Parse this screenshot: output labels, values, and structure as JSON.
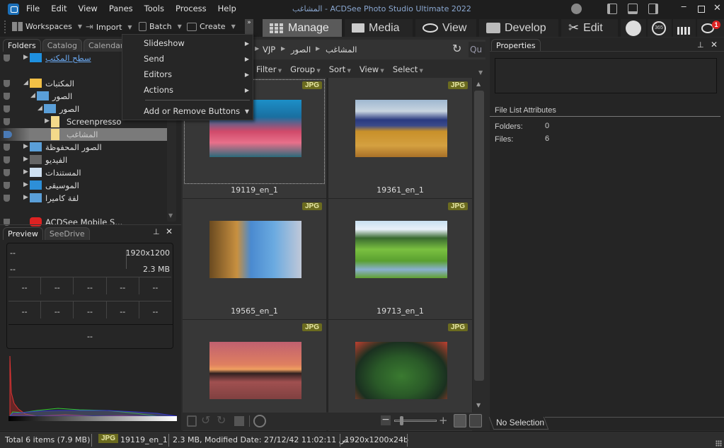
{
  "window": {
    "title": "المشاغب - ACDSee Photo Studio Ultimate 2022",
    "controls": [
      "minimize",
      "maximize",
      "close"
    ]
  },
  "menubar": [
    "File",
    "Edit",
    "View",
    "Panes",
    "Tools",
    "Process",
    "Help"
  ],
  "toolbar": {
    "items": [
      {
        "label": "Workspaces",
        "icon": "workspaces-icon"
      },
      {
        "label": "Import",
        "icon": "import-icon"
      },
      {
        "label": "Batch",
        "icon": "batch-icon"
      },
      {
        "label": "Create",
        "icon": "create-icon"
      }
    ],
    "overflow": "»"
  },
  "modes": [
    {
      "label": "Manage",
      "icon": "grid-icon",
      "active": true
    },
    {
      "label": "Media",
      "icon": "media-icon",
      "active": false
    },
    {
      "label": "View",
      "icon": "eye-icon",
      "active": false
    },
    {
      "label": "Develop",
      "icon": "develop-icon",
      "active": false
    },
    {
      "label": "Edit",
      "icon": "edit-icon",
      "active": false
    }
  ],
  "mode_icons": [
    "people-icon",
    "365-icon",
    "dashboard-icon",
    "notifications-icon"
  ],
  "notification_count": "1",
  "dropdown_menu": {
    "items": [
      "Slideshow",
      "Send",
      "Editors",
      "Actions"
    ],
    "footer": "Add or Remove Buttons"
  },
  "left_pane": {
    "tabs": [
      "Folders",
      "Catalog",
      "Calendar"
    ],
    "tree": [
      {
        "label": "سطح المكتب",
        "level": 0,
        "expander": "collapsed",
        "icon": "desktop-icon",
        "link": true
      },
      {
        "label": "المكتبات",
        "level": 0,
        "expander": "expanded",
        "icon": "libraries-icon"
      },
      {
        "label": "الصور",
        "level": 1,
        "expander": "expanded",
        "icon": "pictures-icon"
      },
      {
        "label": "الصور",
        "level": 2,
        "expander": "expanded",
        "icon": "pictures-icon"
      },
      {
        "label": "Screenpresso",
        "level": 3,
        "expander": "collapsed",
        "icon": "folder-icon"
      },
      {
        "label": "المشاغب",
        "level": 3,
        "expander": "none",
        "icon": "folder-icon",
        "selected": true
      },
      {
        "label": "الصور المحفوظة",
        "level": 0,
        "expander": "collapsed",
        "icon": "pictures-icon"
      },
      {
        "label": "الفيديو",
        "level": 0,
        "expander": "collapsed",
        "icon": "video-icon"
      },
      {
        "label": "المستندات",
        "level": 0,
        "expander": "collapsed",
        "icon": "documents-icon"
      },
      {
        "label": "الموسيقى",
        "level": 0,
        "expander": "collapsed",
        "icon": "music-icon"
      },
      {
        "label": "لفة كاميرا",
        "level": 0,
        "expander": "collapsed",
        "icon": "camera-roll-icon"
      },
      {
        "label": "ACDSee Mobile S...",
        "level": 0,
        "expander": "none",
        "icon": "acdsee-mobile-icon"
      }
    ]
  },
  "preview_pane": {
    "tabs": [
      "Preview",
      "SeeDrive"
    ],
    "top_left": [
      "--",
      "--"
    ],
    "dimensions": "1920x1200",
    "size": "2.3 MB",
    "row1": [
      "--",
      "--",
      "--",
      "--",
      "--"
    ],
    "row2": [
      "--",
      "--",
      "--",
      "--",
      "--"
    ],
    "bottom": "--"
  },
  "breadcrumb": [
    "VJP",
    "الصور",
    "المشاغب"
  ],
  "quick_search": "Qu",
  "filterbar": [
    "Filter",
    "Group",
    "Sort",
    "View",
    "Select"
  ],
  "files": [
    {
      "name": "19119_en_1",
      "type": "JPG",
      "selected": true
    },
    {
      "name": "19361_en_1",
      "type": "JPG"
    },
    {
      "name": "19565_en_1",
      "type": "JPG"
    },
    {
      "name": "19713_en_1",
      "type": "JPG"
    },
    {
      "name": "",
      "type": "JPG"
    },
    {
      "name": "",
      "type": "JPG"
    }
  ],
  "properties": {
    "title": "Properties",
    "section": "File List Attributes",
    "rows": [
      {
        "label": "Folders:",
        "value": "0"
      },
      {
        "label": "Files:",
        "value": "6"
      }
    ],
    "tab": "No Selection"
  },
  "status": {
    "total": "Total 6 items  (7.9 MB)",
    "type": "JPG",
    "file": "19119_en_1",
    "details": "2.3 MB, Modified Date: 27/12/42 11:02:11 ص",
    "image": "1920x1200x24b"
  },
  "colors": {
    "accent_active": "#5a5a5a",
    "badge": "#6b6b1f",
    "selection_flag": "#4a7ab5",
    "notification": "#d22"
  }
}
